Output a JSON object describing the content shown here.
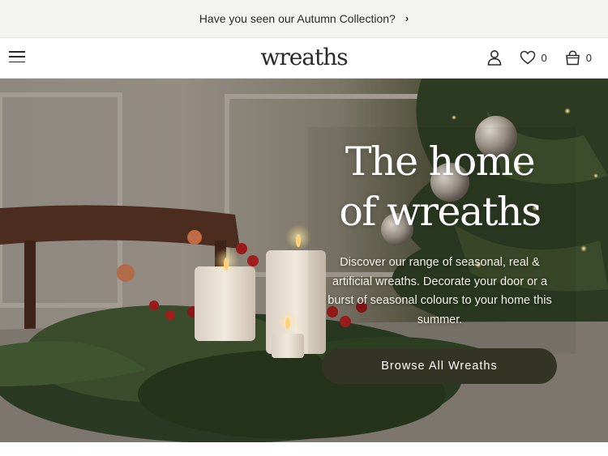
{
  "announcement": {
    "text": "Have you seen our Autumn Collection?",
    "arrow": "›"
  },
  "header": {
    "logo": "wreaths",
    "wishlist_count": "0",
    "cart_count": "0",
    "icons": [
      "menu-icon",
      "user-icon",
      "heart-icon",
      "bag-icon"
    ]
  },
  "hero": {
    "title_line1": "The home",
    "title_line2": "of wreaths",
    "subtitle": "Discover our range of seasonal, real & artificial wreaths. Decorate your door or a burst of seasonal colours to your home this summer.",
    "button_label": "Browse All Wreaths"
  },
  "colors": {
    "announcement_bg": "#f3f3f1",
    "button_bg": "#343424",
    "text": "#2a2a2a"
  }
}
